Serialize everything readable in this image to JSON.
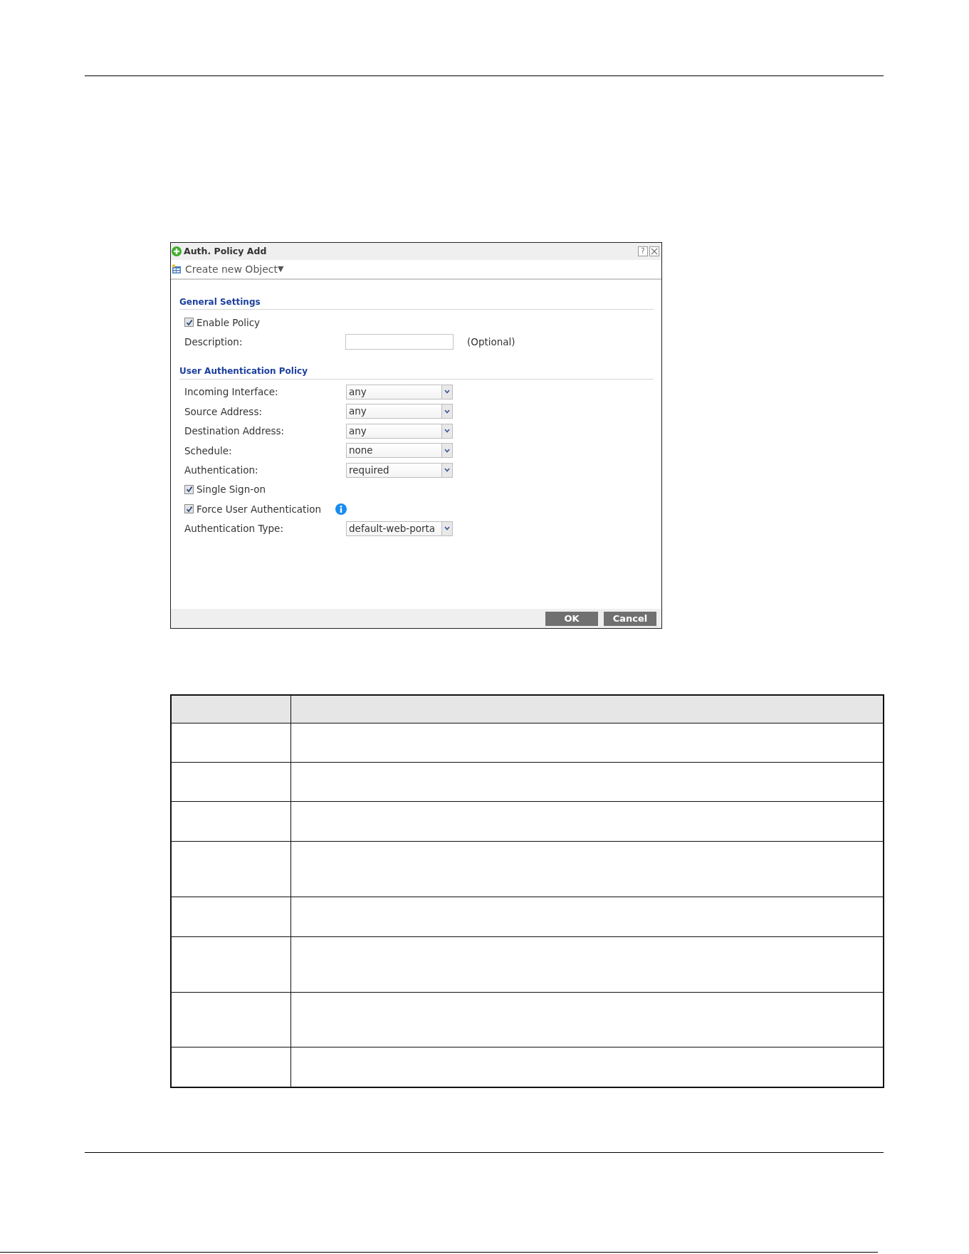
{
  "dialog": {
    "title": "Auth. Policy Add",
    "help": "?"
  },
  "toolbar": {
    "label": "Create new Object",
    "caret": "▼"
  },
  "sections": [
    {
      "title": "General Settings",
      "fields": [
        {
          "kind": "checkbox",
          "label": "Enable Policy",
          "checked": true
        },
        {
          "kind": "text",
          "label": "Description:",
          "note": "(Optional)"
        }
      ]
    },
    {
      "title": "User Authentication Policy",
      "fields": [
        {
          "kind": "select",
          "label": "Incoming Interface:",
          "value": "any"
        },
        {
          "kind": "select",
          "label": "Source Address:",
          "value": "any"
        },
        {
          "kind": "select",
          "label": "Destination Address:",
          "value": "any"
        },
        {
          "kind": "select",
          "label": "Schedule:",
          "value": "none"
        },
        {
          "kind": "select",
          "label": "Authentication:",
          "value": "required"
        },
        {
          "kind": "checkbox",
          "label": "Single Sign-on",
          "checked": true
        },
        {
          "kind": "checkbox",
          "label": "Force User Authentication",
          "checked": true,
          "info": true
        },
        {
          "kind": "select",
          "label": "Authentication Type:",
          "value": "default-web-porta"
        }
      ]
    }
  ],
  "buttons": [
    "OK",
    "Cancel"
  ]
}
